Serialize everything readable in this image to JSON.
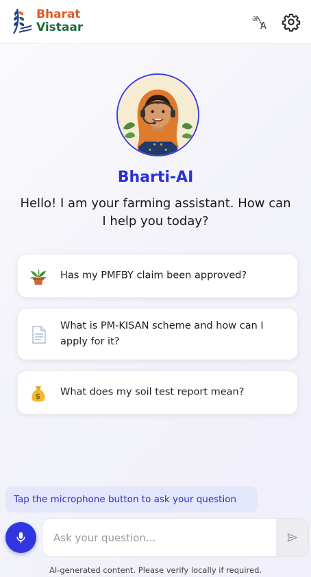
{
  "header": {
    "brand_line1": "Bharat",
    "brand_line2": "Vistaar",
    "brand_colors": {
      "line1": "#e25a24",
      "line2": "#1f6b3a"
    },
    "icons": [
      "translate-icon",
      "gear-icon"
    ]
  },
  "assistant": {
    "name": "Bharti-AI",
    "greeting": "Hello! I am your farming assistant. How can I help you today?",
    "accent_color": "#2b30d9"
  },
  "suggestions": [
    {
      "icon": "potted-plant-icon",
      "text": "Has my PMFBY claim been approved?"
    },
    {
      "icon": "document-icon",
      "text": "What is PM-KISAN scheme and how can I apply for it?"
    },
    {
      "icon": "money-bag-icon",
      "text": "What does my soil test report mean?"
    }
  ],
  "composer": {
    "mic_hint": "Tap the microphone button to ask your question",
    "placeholder": "Ask your question...",
    "mic_icon": "microphone-icon",
    "send_icon": "send-icon"
  },
  "footer": {
    "disclaimer": "AI-generated content. Please verify locally if required."
  }
}
